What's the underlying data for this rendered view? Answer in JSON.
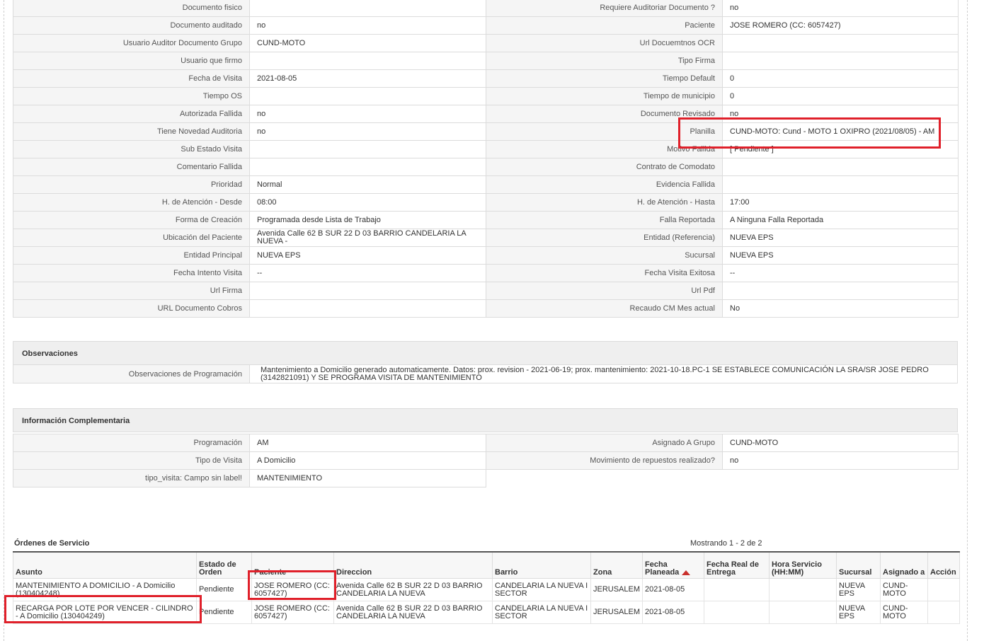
{
  "details": [
    {
      "l1": "Documento fisico",
      "v1": "",
      "l2": "Requiere Auditoriar Documento ?",
      "v2": "no"
    },
    {
      "l1": "Documento auditado",
      "v1": "no",
      "l2": "Paciente",
      "v2": "JOSE ROMERO (CC: 6057427)"
    },
    {
      "l1": "Usuario Auditor Documento Grupo",
      "v1": "CUND-MOTO",
      "l2": "Url Docuemtnos OCR",
      "v2": ""
    },
    {
      "l1": "Usuario que firmo",
      "v1": "",
      "l2": "Tipo Firma",
      "v2": ""
    },
    {
      "l1": "Fecha de Visita",
      "v1": "2021-08-05",
      "l2": "Tiempo Default",
      "v2": "0"
    },
    {
      "l1": "Tiempo OS",
      "v1": "",
      "l2": "Tiempo de municipio",
      "v2": "0"
    },
    {
      "l1": "Autorizada Fallida",
      "v1": "no",
      "l2": "Documento Revisado",
      "v2": "no"
    },
    {
      "l1": "Tiene Novedad Auditoria",
      "v1": "no",
      "l2": "Planilla",
      "v2": "CUND-MOTO: Cund - MOTO 1 OXIPRO (2021/08/05) - AM"
    },
    {
      "l1": "Sub Estado Visita",
      "v1": "",
      "l2": "Motivo Fallida",
      "v2": "[ Pendiente ]"
    },
    {
      "l1": "Comentario Fallida",
      "v1": "",
      "l2": "Contrato de Comodato",
      "v2": ""
    },
    {
      "l1": "Prioridad",
      "v1": "Normal",
      "l2": "Evidencia Fallida",
      "v2": ""
    },
    {
      "l1": "H. de Atención - Desde",
      "v1": "08:00",
      "l2": "H. de Atención - Hasta",
      "v2": "17:00"
    },
    {
      "l1": "Forma de Creación",
      "v1": "Programada desde Lista de Trabajo",
      "l2": "Falla Reportada",
      "v2": "A Ninguna Falla Reportada"
    },
    {
      "l1": "Ubicación del Paciente",
      "v1": "Avenida Calle 62 B SUR 22 D 03 BARRIO CANDELARIA LA NUEVA -",
      "l2": "Entidad (Referencia)",
      "v2": "NUEVA EPS"
    },
    {
      "l1": "Entidad Principal",
      "v1": "NUEVA EPS",
      "l2": "Sucursal",
      "v2": "NUEVA EPS"
    },
    {
      "l1": "Fecha Intento Visita",
      "v1": "--",
      "l2": "Fecha Visita Exitosa",
      "v2": "--"
    },
    {
      "l1": "Url Firma",
      "v1": "",
      "l2": "Url Pdf",
      "v2": ""
    },
    {
      "l1": "URL Documento Cobros",
      "v1": "",
      "l2": "Recaudo CM Mes actual",
      "v2": "No"
    }
  ],
  "observaciones": {
    "title": "Observaciones",
    "label": "Observaciones de Programación",
    "value": "Mantenimiento a Domicilio generado automaticamente. Datos: prox. revision - 2021-06-19; prox. mantenimiento: 2021-10-18.PC-1 SE ESTABLECE COMUNICACIÓN LA SRA/SR JOSE PEDRO (3142821091) Y SE PROGRAMA VISITA DE MANTENIMIENTO"
  },
  "complementaria": {
    "title": "Información Complementaria",
    "rows": [
      {
        "l1": "Programación",
        "v1": "AM",
        "l2": "Asignado A Grupo",
        "v2": "CUND-MOTO"
      },
      {
        "l1": "Tipo de Visita",
        "v1": "A Domicilio",
        "l2": "Movimiento de repuestos realizado?",
        "v2": "no"
      },
      {
        "l1": "tipo_visita: Campo sin label!",
        "v1": "MANTENIMIENTO"
      }
    ]
  },
  "ordenes": {
    "title": "Órdenes de Servicio",
    "count": "Mostrando 1 - 2 de 2",
    "columns": [
      "Asunto",
      "Estado de Orden",
      "Paciente",
      "Direccion",
      "Barrio",
      "Zona",
      "Fecha Planeada",
      "Fecha Real de Entrega",
      "Hora Servicio (HH:MM)",
      "Sucursal",
      "Asignado a",
      "Acción"
    ],
    "rows": [
      [
        "MANTENIMIENTO A DOMICILIO - A Domicilio (130404248)",
        "Pendiente",
        "JOSE ROMERO (CC: 6057427)",
        "Avenida Calle 62 B SUR 22 D 03 BARRIO CANDELARIA LA NUEVA",
        "CANDELARIA LA NUEVA I SECTOR",
        "JERUSALEM",
        "2021-08-05",
        "",
        "",
        "NUEVA EPS",
        "CUND-MOTO",
        ""
      ],
      [
        "RECARGA POR LOTE POR VENCER - CILINDRO - A Domicilio (130404249)",
        "Pendiente",
        "JOSE ROMERO (CC: 6057427)",
        "Avenida Calle 62 B SUR 22 D 03 BARRIO CANDELARIA LA NUEVA",
        "CANDELARIA LA NUEVA I SECTOR",
        "JERUSALEM",
        "2021-08-05",
        "",
        "",
        "NUEVA EPS",
        "CUND-MOTO",
        ""
      ]
    ]
  },
  "highlight_color": "#e0202a"
}
